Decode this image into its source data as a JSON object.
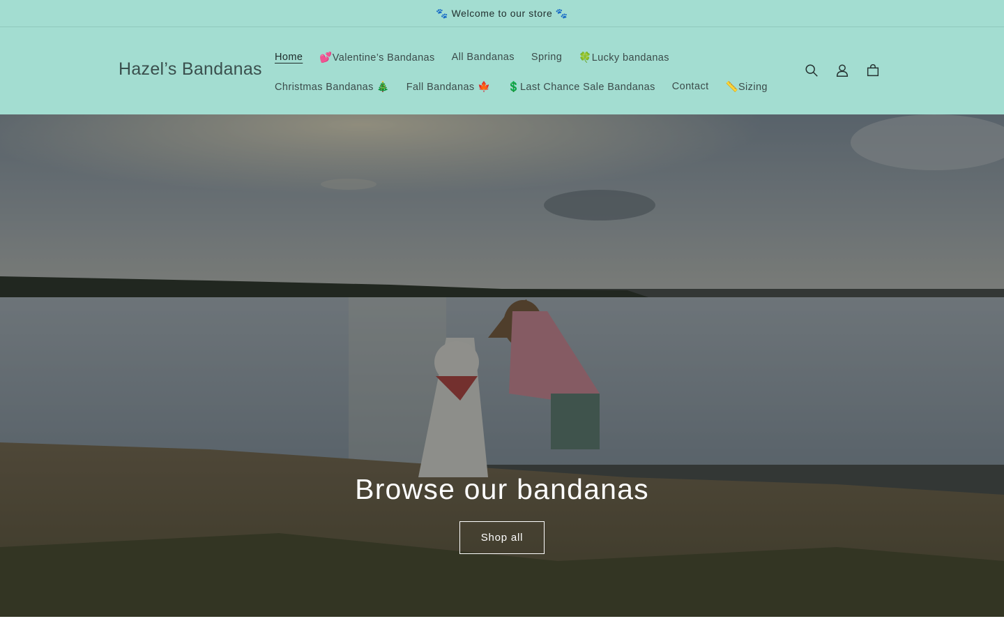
{
  "announcement": {
    "text": "🐾 Welcome to our store 🐾"
  },
  "header": {
    "logo": "Hazel’s Bandanas",
    "nav_row1": [
      {
        "label": "Home",
        "active": true
      },
      {
        "label": "💕Valentine’s Bandanas"
      },
      {
        "label": "All Bandanas"
      },
      {
        "label": "Spring"
      },
      {
        "label": "🍀Lucky bandanas"
      }
    ],
    "nav_row2": [
      {
        "label": "Christmas Bandanas 🎄"
      },
      {
        "label": "Fall Bandanas 🍁"
      },
      {
        "label": "💲Last Chance Sale Bandanas"
      },
      {
        "label": "Contact"
      },
      {
        "label": "📏Sizing"
      }
    ],
    "icons": [
      "search-icon",
      "account-icon",
      "cart-icon"
    ]
  },
  "hero": {
    "heading": "Browse our bandanas",
    "button_label": "Shop all"
  },
  "colors": {
    "header_bg": "#a3ddd1",
    "text": "#2b3b3a",
    "hero_text": "#ffffff"
  }
}
